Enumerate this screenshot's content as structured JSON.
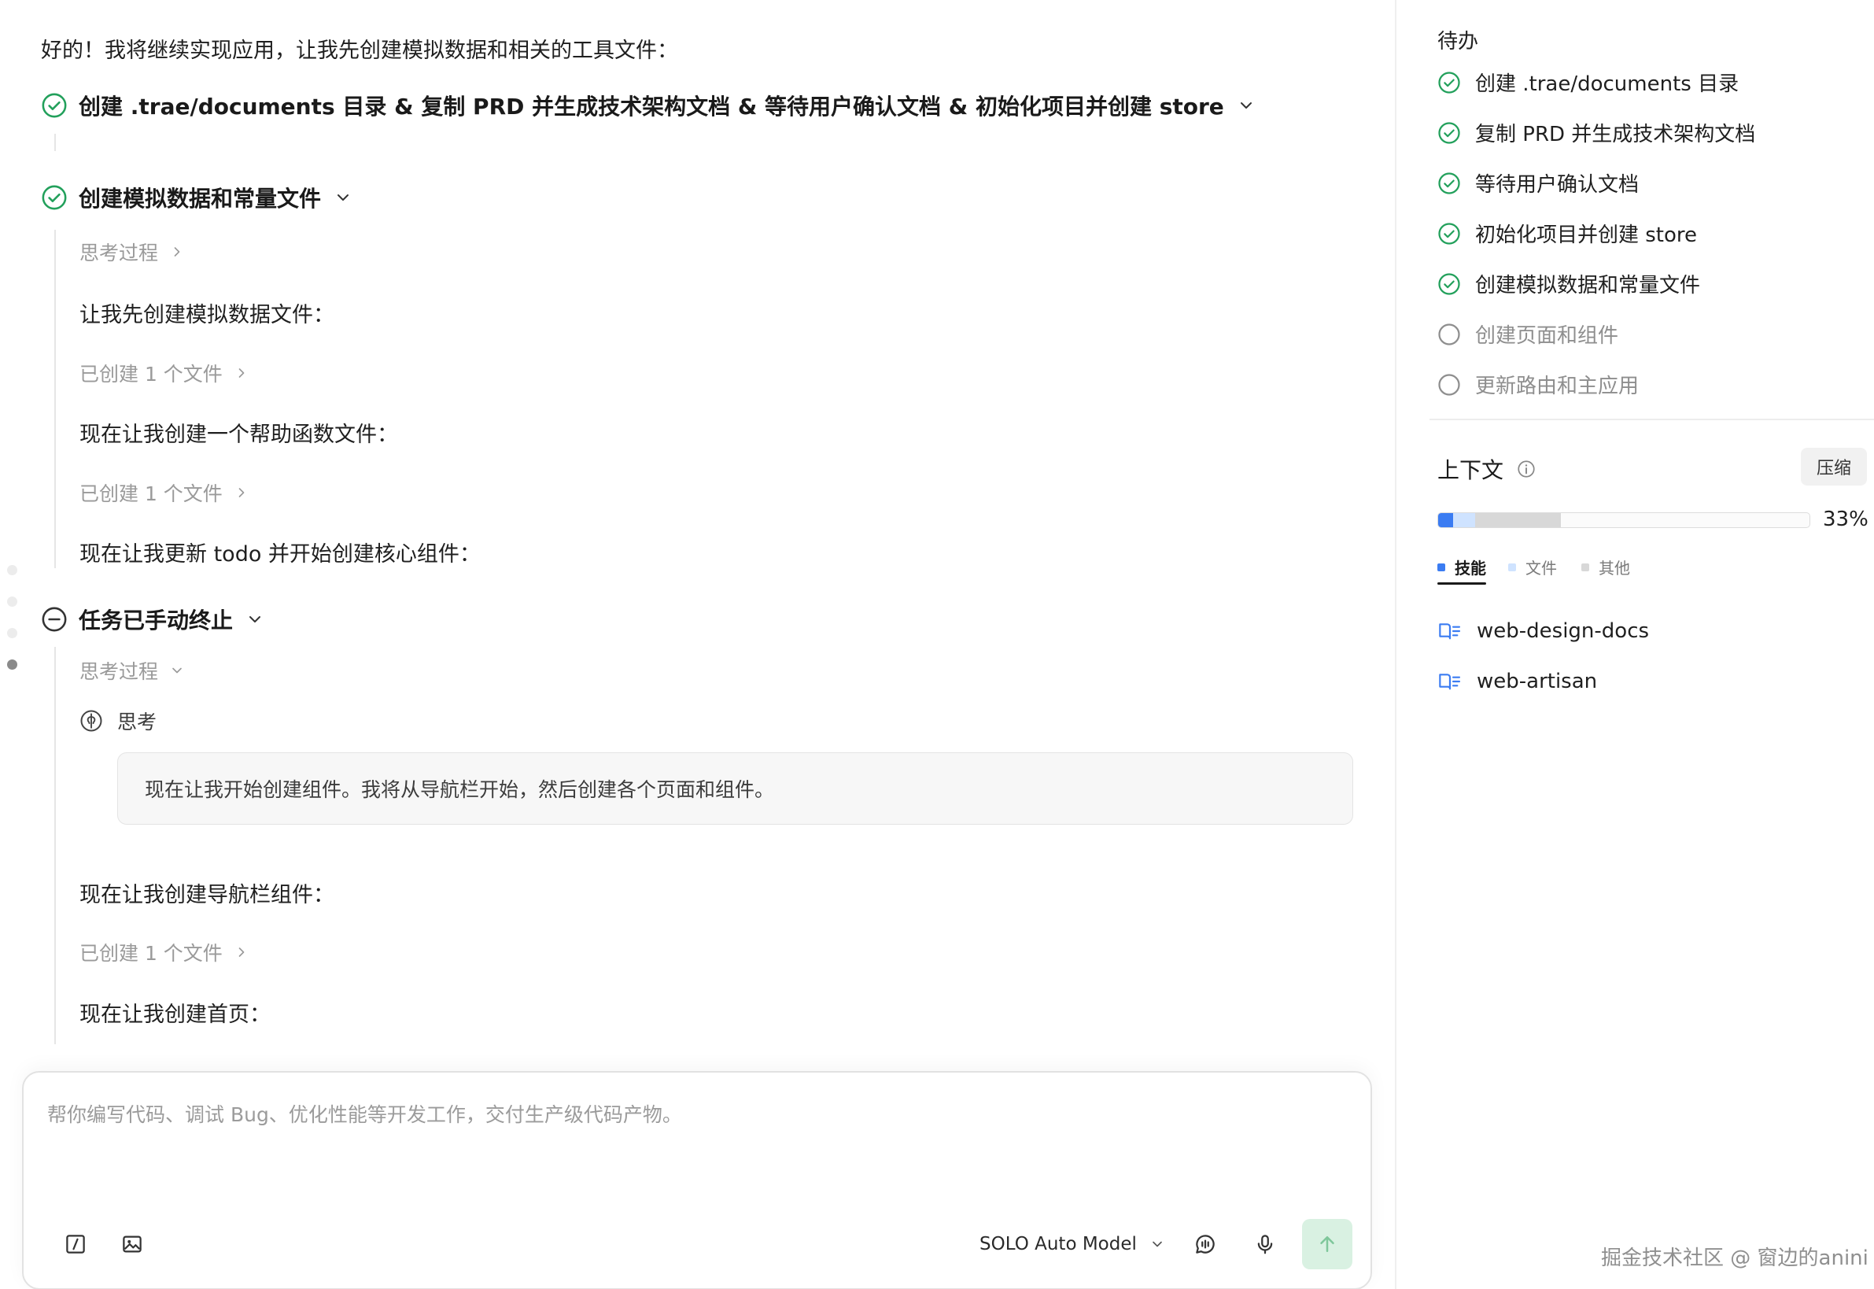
{
  "chat": {
    "intro": "好的！我将继续实现应用，让我先创建模拟数据和相关的工具文件：",
    "step1_title": "创建 .trae/documents 目录 & 复制 PRD 并生成技术架构文档 & 等待用户确认文档 & 初始化项目并创建 store",
    "step2_title": "创建模拟数据和常量文件",
    "step2_thinking": "思考过程",
    "step2_msg1": "让我先创建模拟数据文件：",
    "step2_files1": "已创建 1 个文件",
    "step2_msg2": "现在让我创建一个帮助函数文件：",
    "step2_files2": "已创建 1 个文件",
    "step2_msg3": "现在让我更新 todo 并开始创建核心组件：",
    "step3_title": "任务已手动终止",
    "step3_thinking": "思考过程",
    "step3_think_label": "思考",
    "step3_think_content": "现在让我开始创建组件。我将从导航栏开始，然后创建各个页面和组件。",
    "step3_msg1": "现在让我创建导航栏组件：",
    "step3_files1": "已创建 1 个文件",
    "step3_msg2": "现在让我创建首页："
  },
  "input": {
    "placeholder": "帮你编写代码、调试 Bug、优化性能等开发工作，交付生产级代码产物。",
    "value": "",
    "model": "SOLO Auto Model"
  },
  "panel": {
    "todo_title": "待办",
    "todos": [
      {
        "label": "创建 .trae/documents 目录",
        "done": true
      },
      {
        "label": "复制 PRD 并生成技术架构文档",
        "done": true
      },
      {
        "label": "等待用户确认文档",
        "done": true
      },
      {
        "label": "初始化项目并创建 store",
        "done": true
      },
      {
        "label": "创建模拟数据和常量文件",
        "done": true
      },
      {
        "label": "创建页面和组件",
        "done": false
      },
      {
        "label": "更新路由和主应用",
        "done": false
      }
    ],
    "context_title": "上下文",
    "compress_label": "压缩",
    "context_percent": "33%",
    "usage": {
      "skills": 0.04,
      "files": 0.06,
      "others": 0.23
    },
    "legend": [
      {
        "label": "技能",
        "color": "#3b7cf2"
      },
      {
        "label": "文件",
        "color": "#cfe3ff"
      },
      {
        "label": "其他",
        "color": "#d8d8d8"
      }
    ],
    "skills": [
      "web-design-docs",
      "web-artisan"
    ]
  },
  "watermark": "掘金技术社区 @ 窗边的anini",
  "colors": {
    "success": "#22a05b",
    "accent": "#3b7cf2",
    "pending": "#8e8e8e"
  }
}
